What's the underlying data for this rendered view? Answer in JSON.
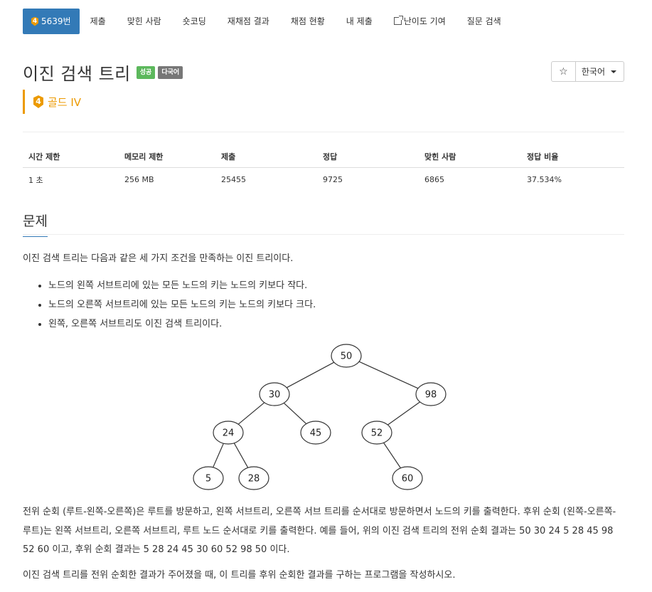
{
  "nav": {
    "problem_id": "5639번",
    "tier_digit": "4",
    "items": [
      "제출",
      "맞힌 사람",
      "숏코딩",
      "재채점 결과",
      "채점 현황",
      "난이도 기여",
      "내 제출",
      "질문 검색"
    ]
  },
  "title": {
    "text": "이진 검색 트리",
    "badges": [
      "성공",
      "다국어"
    ]
  },
  "actions": {
    "star": "☆",
    "language": "한국어"
  },
  "tier": {
    "digit": "4",
    "label": "골드 IV"
  },
  "info_table": {
    "headers": [
      "시간 제한",
      "메모리 제한",
      "제출",
      "정답",
      "맞힌 사람",
      "정답 비율"
    ],
    "values": [
      "1 초",
      "256 MB",
      "25455",
      "9725",
      "6865",
      "37.534%"
    ]
  },
  "section": {
    "title": "문제"
  },
  "problem": {
    "intro": "이진 검색 트리는 다음과 같은 세 가지 조건을 만족하는 이진 트리이다.",
    "rules": [
      "노드의 왼쪽 서브트리에 있는 모든 노드의 키는 노드의 키보다 작다.",
      "노드의 오른쪽 서브트리에 있는 모든 노드의 키는 노드의 키보다 크다.",
      "왼쪽, 오른쪽 서브트리도 이진 검색 트리이다."
    ],
    "paragraph1": "전위 순회 (루트-왼쪽-오른쪽)은 루트를 방문하고, 왼쪽 서브트리, 오른쪽 서브 트리를 순서대로 방문하면서 노드의 키를 출력한다. 후위 순회 (왼쪽-오른쪽-루트)는 왼쪽 서브트리, 오른쪽 서브트리, 루트 노드 순서대로 키를 출력한다. 예를 들어, 위의 이진 검색 트리의 전위 순회 결과는 50 30 24 5 28 45 98 52 60 이고, 후위 순회 결과는 5 28 24 45 30 60 52 98 50 이다.",
    "paragraph2": "이진 검색 트리를 전위 순회한 결과가 주어졌을 때, 이 트리를 후위 순회한 결과를 구하는 프로그램을 작성하시오."
  },
  "tree": {
    "nodes": [
      "50",
      "30",
      "98",
      "24",
      "45",
      "52",
      "5",
      "28",
      "60"
    ],
    "edges": [
      [
        "50",
        "30"
      ],
      [
        "50",
        "98"
      ],
      [
        "30",
        "24"
      ],
      [
        "30",
        "45"
      ],
      [
        "98",
        "52"
      ],
      [
        "24",
        "5"
      ],
      [
        "24",
        "28"
      ],
      [
        "52",
        "60"
      ]
    ]
  }
}
